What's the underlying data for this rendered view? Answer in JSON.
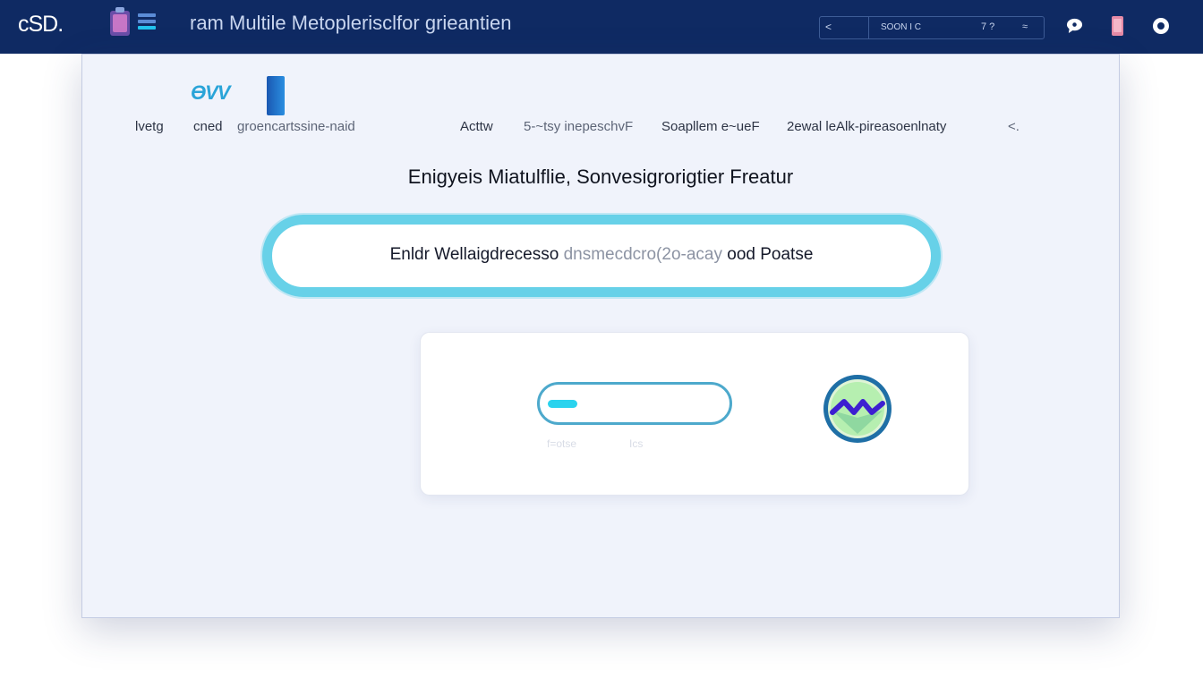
{
  "topbar": {
    "logo": "cSD.",
    "title": "ram Multile Metoplerisclfor grieantien",
    "search": {
      "glyph_left": "<",
      "text": "SOON  I C",
      "glyph_mid": "7  ?",
      "glyph_right": "≈"
    },
    "icons": [
      "app-icon",
      "menu-icon",
      "chat-icon",
      "phone-icon",
      "user-icon"
    ]
  },
  "panel": {
    "brand": {
      "part1": "ӨV",
      "part2": "V"
    },
    "nav": [
      "lvetg",
      "cned",
      "groencartssine-naid",
      "Acttw",
      "5-~tsy inepeschvF",
      "Soapllem e~ueF",
      "2ewal leAlk-pireasoenlnaty",
      "<."
    ],
    "heading": "Enigyeis Miatulflie, Sonvesigrorigtier  Freatur",
    "pill": {
      "text_start": "Enldr Wellaigdrecesso ",
      "text_dim": "dnsmecdcro(2o-acay",
      "text_end": " ood Poatse"
    },
    "card": {
      "progress": 0.07,
      "caption_1": "f=otse",
      "caption_2": "Ics"
    }
  },
  "colors": {
    "topbar": "#0f2a63",
    "panel": "#f0f3fb",
    "accent": "#67d1e8",
    "progress_fill": "#2ad3ee",
    "status_ring": "#1f6fa6",
    "status_fill": "#b6efb0",
    "status_wave": "#3d1fd1"
  }
}
